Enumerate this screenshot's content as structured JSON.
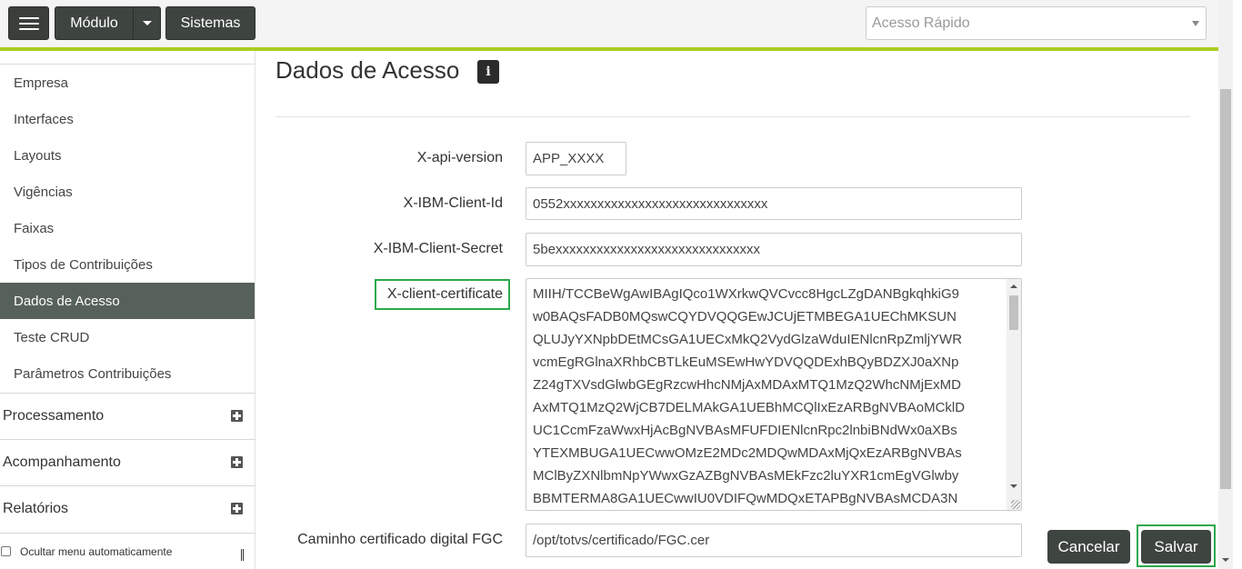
{
  "topbar": {
    "modulo_label": "Módulo",
    "sistemas_label": "Sistemas",
    "quick_access_placeholder": "Acesso Rápido"
  },
  "sidebar": {
    "items": [
      {
        "label": "Empresa"
      },
      {
        "label": "Interfaces"
      },
      {
        "label": "Layouts"
      },
      {
        "label": "Vigências"
      },
      {
        "label": "Faixas"
      },
      {
        "label": "Tipos de Contribuições"
      },
      {
        "label": "Dados de Acesso",
        "active": true
      },
      {
        "label": "Teste CRUD"
      },
      {
        "label": "Parâmetros Contribuições"
      }
    ],
    "groups": [
      {
        "label": "Processamento"
      },
      {
        "label": "Acompanhamento"
      },
      {
        "label": "Relatórios"
      }
    ],
    "hide_menu_label": "Ocultar menu automaticamente"
  },
  "page": {
    "title": "Dados de Acesso"
  },
  "form": {
    "api_version": {
      "label": "X-api-version",
      "value": "APP_XXXX"
    },
    "client_id": {
      "label": "X-IBM-Client-Id",
      "value": "0552xxxxxxxxxxxxxxxxxxxxxxxxxxxxxx"
    },
    "client_secret": {
      "label": "X-IBM-Client-Secret",
      "value": "5bexxxxxxxxxxxxxxxxxxxxxxxxxxxxxx"
    },
    "client_certificate": {
      "label": "X-client-certificate",
      "lines": [
        "MIIH/TCCBeWgAwIBAgIQco1WXrkwQVCvcc8HgcLZgDANBgkqhkiG9",
        "w0BAQsFADB0MQswCQYDVQQGEwJCUjETMBEGA1UEChMKSUN",
        "QLUJyYXNpbDEtMCsGA1UECxMkQ2VydGlzaWduIENlcnRpZmljYWR",
        "vcmEgRGlnaXRhbCBTLkEuMSEwHwYDVQQDExhBQyBDZXJ0aXNp",
        "Z24gTXVsdGlwbGEgRzcwHhcNMjAxMDAxMTQ1MzQ2WhcNMjExMD",
        "AxMTQ1MzQ2WjCB7DELMAkGA1UEBhMCQlIxEzARBgNVBAoMCklD",
        "UC1CcmFzaWwxHjAcBgNVBAsMFUFDIENlcnRpc2lnbiBNdWx0aXBs",
        "YTEXMBUGA1UECwwOMzE2MDc2MDQwMDAxMjQxEzARBgNVBAs",
        "MClByZXNlbmNpYWwxGzAZBgNVBAsMEkFzc2luYXR1cmEgVGlwby",
        "BBMTERMA8GA1UECwwIU0VDIFQwMDQxETAPBgNVBAsMCDA3N"
      ]
    },
    "cert_path": {
      "label": "Caminho certificado digital FGC",
      "value": "/opt/totvs/certificado/FGC.cer"
    }
  },
  "actions": {
    "cancel_label": "Cancelar",
    "save_label": "Salvar"
  }
}
